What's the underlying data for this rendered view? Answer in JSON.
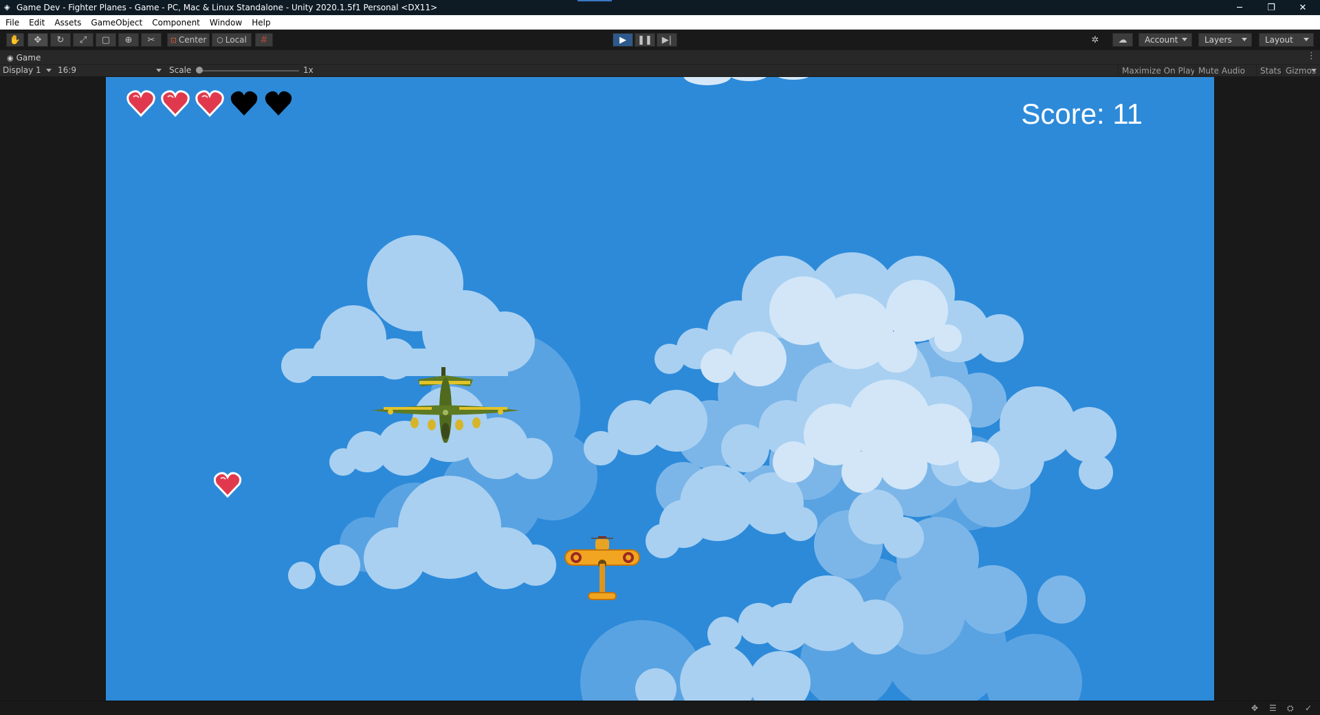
{
  "window": {
    "title": "Game Dev - Fighter Planes - Game - PC, Mac & Linux Standalone - Unity 2020.1.5f1 Personal <DX11>",
    "minimize": "─",
    "restore": "❐",
    "close": "✕"
  },
  "menu": [
    "File",
    "Edit",
    "Assets",
    "GameObject",
    "Component",
    "Window",
    "Help"
  ],
  "toolbar": {
    "pivot_center": "Center",
    "pivot_local": "Local",
    "account": "Account",
    "layers": "Layers",
    "layout": "Layout"
  },
  "tab": {
    "label": "Game"
  },
  "game_controls": {
    "display": "Display 1",
    "aspect": "16:9",
    "scale_label": "Scale",
    "scale_value": "1x",
    "maximize_on_play": "Maximize On Play",
    "mute_audio": "Mute Audio",
    "stats": "Stats",
    "gizmos": "Gizmos"
  },
  "game": {
    "score_text": "Score: 11",
    "lives_total": 5,
    "lives_remaining": 3,
    "heart_color": "#e0394d",
    "lost_heart_color": "#000000",
    "sky_color": "#2d8ad9"
  }
}
